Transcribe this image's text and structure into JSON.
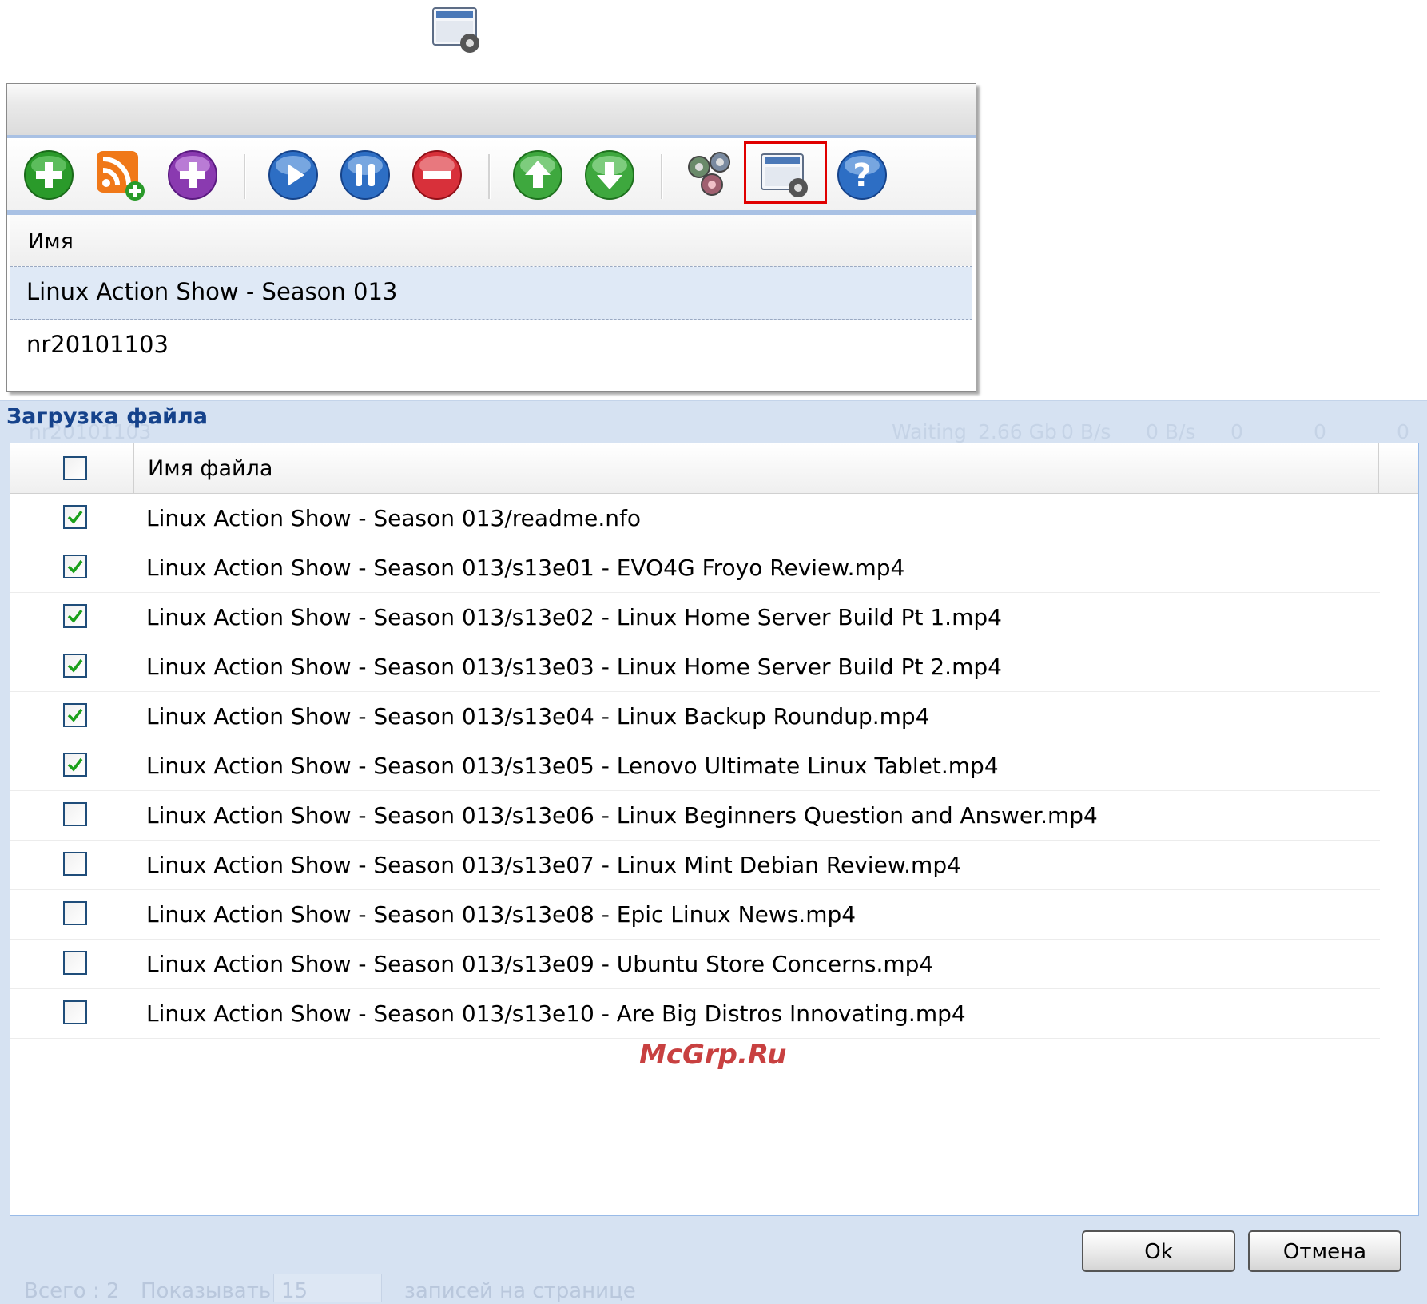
{
  "callout": {
    "icon": "preferences-window-icon"
  },
  "toolbar": {
    "buttons": [
      {
        "icon": "add-green-icon",
        "color": "#2a9a2a"
      },
      {
        "icon": "rss-add-icon",
        "color": "#f07818"
      },
      {
        "icon": "add-purple-icon",
        "color": "#8a3ab0"
      },
      {
        "icon": "play-icon",
        "color": "#2d6ec4"
      },
      {
        "icon": "pause-icon",
        "color": "#2d6ec4"
      },
      {
        "icon": "remove-icon",
        "color": "#d8303a"
      },
      {
        "icon": "move-up-icon",
        "color": "#3ea83e"
      },
      {
        "icon": "move-down-icon",
        "color": "#3ea83e"
      },
      {
        "icon": "settings-gears-icon",
        "color": "#6a8a6a"
      },
      {
        "icon": "task-settings-icon",
        "color": "#4a78b8"
      },
      {
        "icon": "help-icon",
        "color": "#2d6ec4"
      }
    ],
    "highlighted": "task-settings-icon",
    "highlight_color": "#e00000"
  },
  "task_grid": {
    "column_header": "Имя",
    "rows": [
      {
        "name": "Linux Action Show - Season 013",
        "selected": true
      },
      {
        "name": "nr20101103",
        "selected": false
      }
    ]
  },
  "dialog": {
    "title": "Загрузка файла",
    "background_ghost": {
      "task": "nr20101103",
      "status": "Waiting",
      "size": "2.66 Gb",
      "down_speed": "0 B/s",
      "up_speed": "0 B/s",
      "seeds": "0",
      "peers": "0",
      "extra": "0"
    },
    "file_column_header": "Имя файла",
    "select_all_checked": false,
    "files": [
      {
        "name": "Linux Action Show - Season 013/readme.nfo",
        "checked": true
      },
      {
        "name": "Linux Action Show - Season 013/s13e01 - EVO4G Froyo Review.mp4",
        "checked": true
      },
      {
        "name": "Linux Action Show - Season 013/s13e02 - Linux Home Server Build Pt 1.mp4",
        "checked": true
      },
      {
        "name": "Linux Action Show - Season 013/s13e03 - Linux Home Server Build Pt 2.mp4",
        "checked": true
      },
      {
        "name": "Linux Action Show - Season 013/s13e04 - Linux Backup Roundup.mp4",
        "checked": true
      },
      {
        "name": "Linux Action Show - Season 013/s13e05 - Lenovo Ultimate Linux Tablet.mp4",
        "checked": true
      },
      {
        "name": "Linux Action Show - Season 013/s13e06 - Linux Beginners Question and Answer.mp4",
        "checked": false
      },
      {
        "name": "Linux Action Show - Season 013/s13e07 - Linux Mint Debian Review.mp4",
        "checked": false
      },
      {
        "name": "Linux Action Show - Season 013/s13e08 - Epic Linux News.mp4",
        "checked": false
      },
      {
        "name": "Linux Action Show - Season 013/s13e09 - Ubuntu Store Concerns.mp4",
        "checked": false
      },
      {
        "name": "Linux Action Show - Season 013/s13e10 - Are Big Distros Innovating.mp4",
        "checked": false
      }
    ],
    "ok_label": "Ok",
    "cancel_label": "Отмена",
    "footer_ghost": {
      "total": "Всего : 2",
      "show": "Показывать",
      "per_page_value": "15",
      "per_page_suffix": "записей на странице"
    }
  },
  "watermark": "McGrp.Ru"
}
